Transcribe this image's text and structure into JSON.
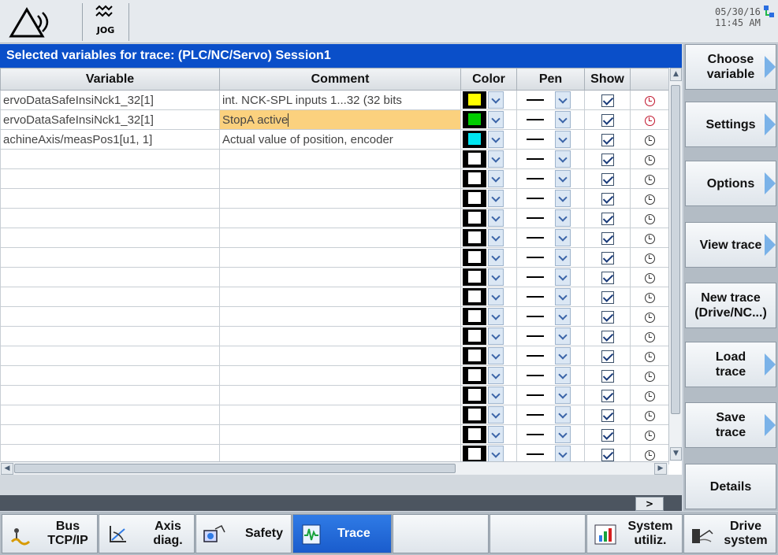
{
  "header": {
    "mode": "JOG",
    "date": "05/30/16",
    "time": "11:45 AM"
  },
  "panel": {
    "title": "Selected variables for trace:  (PLC/NC/Servo) Session1",
    "columns": [
      "Variable",
      "Comment",
      "Color",
      "Pen",
      "Show"
    ],
    "rows": [
      {
        "variable": "ervoDataSafeInsiNck1_32[1]",
        "comment": "int. NCK-SPL inputs 1...32 (32 bits",
        "color": "#ffff00",
        "clock": "red"
      },
      {
        "variable": "ervoDataSafeInsiNck1_32[1]",
        "comment": "StopA active",
        "color": "#00cc00",
        "clock": "red"
      },
      {
        "variable": "achineAxis/measPos1[u1, 1]",
        "comment": "Actual value of position, encoder",
        "color": "#00e5f0",
        "clock": "normal"
      },
      {
        "variable": "",
        "comment": "",
        "color": "#ffffff",
        "clock": "normal"
      },
      {
        "variable": "",
        "comment": "",
        "color": "#ffffff",
        "clock": "normal"
      },
      {
        "variable": "",
        "comment": "",
        "color": "#ffffff",
        "clock": "normal"
      },
      {
        "variable": "",
        "comment": "",
        "color": "#ffffff",
        "clock": "normal"
      },
      {
        "variable": "",
        "comment": "",
        "color": "#ffffff",
        "clock": "normal"
      },
      {
        "variable": "",
        "comment": "",
        "color": "#ffffff",
        "clock": "normal"
      },
      {
        "variable": "",
        "comment": "",
        "color": "#ffffff",
        "clock": "normal"
      },
      {
        "variable": "",
        "comment": "",
        "color": "#ffffff",
        "clock": "normal"
      },
      {
        "variable": "",
        "comment": "",
        "color": "#ffffff",
        "clock": "normal"
      },
      {
        "variable": "",
        "comment": "",
        "color": "#ffffff",
        "clock": "normal"
      },
      {
        "variable": "",
        "comment": "",
        "color": "#ffffff",
        "clock": "normal"
      },
      {
        "variable": "",
        "comment": "",
        "color": "#ffffff",
        "clock": "normal"
      },
      {
        "variable": "",
        "comment": "",
        "color": "#ffffff",
        "clock": "normal"
      },
      {
        "variable": "",
        "comment": "",
        "color": "#ffffff",
        "clock": "normal"
      },
      {
        "variable": "",
        "comment": "",
        "color": "#ffffff",
        "clock": "normal"
      },
      {
        "variable": "",
        "comment": "",
        "color": "#ffffff",
        "clock": "normal"
      }
    ]
  },
  "softkeys": {
    "choose_variable": "Choose variable",
    "settings": "Settings",
    "options": "Options",
    "view_trace": "View trace",
    "new_trace": "New trace (Drive/NC...)",
    "load_trace": "Load trace",
    "save_trace": "Save trace",
    "details": "Details"
  },
  "more_label": ">",
  "bottomkeys": {
    "bus": "Bus TCP/IP",
    "axis": "Axis diag.",
    "safety": "Safety",
    "trace": "Trace",
    "system": "System utiliz.",
    "drive": "Drive system"
  }
}
